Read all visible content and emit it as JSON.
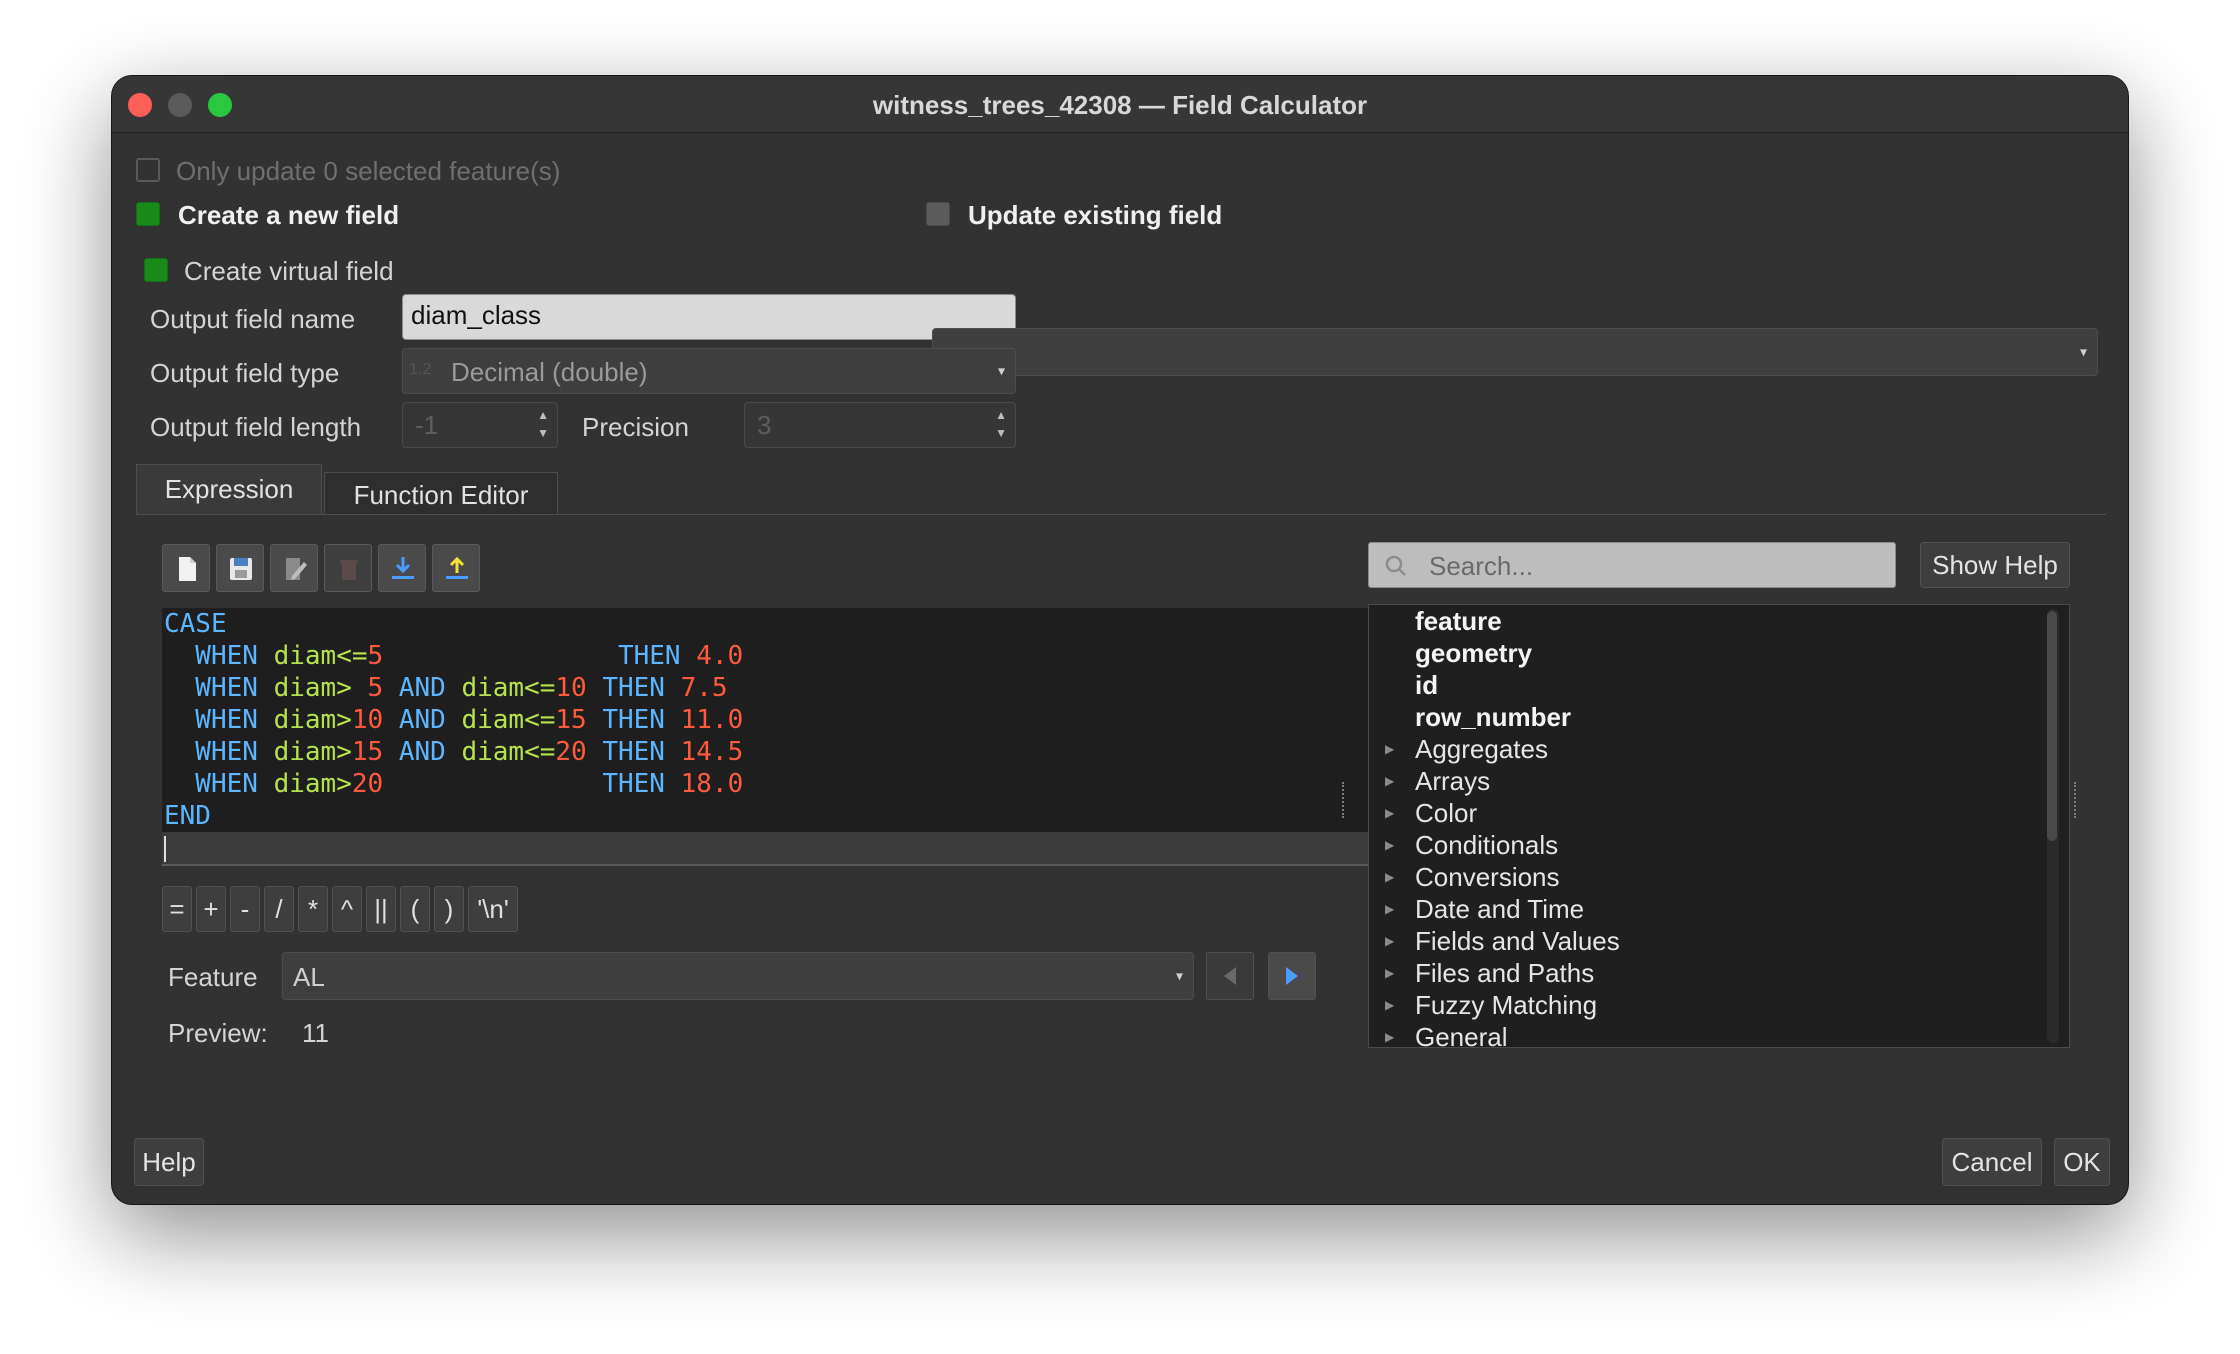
{
  "window": {
    "title": "witness_trees_42308 — Field Calculator"
  },
  "options": {
    "only_update": "Only update 0 selected feature(s)",
    "create_new_field": "Create a new field",
    "update_existing_field": "Update existing field",
    "create_virtual_field": "Create virtual field"
  },
  "fields": {
    "output_name_label": "Output field name",
    "output_name_value": "diam_class",
    "output_type_label": "Output field type",
    "output_type_icon": "1.2",
    "output_type_value": "Decimal (double)",
    "output_length_label": "Output field length",
    "output_length_value": "-1",
    "precision_label": "Precision",
    "precision_value": "3"
  },
  "tabs": [
    {
      "label": "Expression"
    },
    {
      "label": "Function Editor"
    }
  ],
  "toolbar_icons": [
    "new-file-icon",
    "save-icon",
    "edit-icon",
    "delete-icon",
    "import-icon",
    "export-icon"
  ],
  "expression": {
    "lines": [
      {
        "a": "CASE"
      },
      {
        "kw1": "  WHEN ",
        "id1": "diam<=",
        "n1": "5",
        "sp": "               ",
        "kw2": "THEN ",
        "n2": "4.0"
      },
      {
        "kw1": "  WHEN ",
        "id1": "diam> ",
        "n1": "5",
        "mid": " AND ",
        "id2": "diam<=",
        "n1b": "10",
        "kw2": " THEN ",
        "n2": "7.5"
      },
      {
        "kw1": "  WHEN ",
        "id1": "diam>",
        "n1": "10",
        "mid": " AND ",
        "id2": "diam<=",
        "n1b": "15",
        "kw2": " THEN ",
        "n2": "11.0"
      },
      {
        "kw1": "  WHEN ",
        "id1": "diam>",
        "n1": "15",
        "mid": " AND ",
        "id2": "diam<=",
        "n1b": "20",
        "kw2": " THEN ",
        "n2": "14.5"
      },
      {
        "kw1": "  WHEN ",
        "id1": "diam>",
        "n1": "20",
        "sp": "              ",
        "kw2": "THEN ",
        "n2": "18.0"
      },
      {
        "a": "END"
      }
    ]
  },
  "operators": [
    "=",
    "+",
    "-",
    "/",
    "*",
    "^",
    "||",
    "(",
    ")",
    "'\\n'"
  ],
  "feature": {
    "label": "Feature",
    "value": "AL"
  },
  "preview": {
    "label": "Preview:",
    "value": "11"
  },
  "search": {
    "placeholder": "Search..."
  },
  "show_help": "Show Help",
  "tree": {
    "fields": [
      "feature",
      "geometry",
      "id",
      "row_number"
    ],
    "groups": [
      "Aggregates",
      "Arrays",
      "Color",
      "Conditionals",
      "Conversions",
      "Date and Time",
      "Fields and Values",
      "Files and Paths",
      "Fuzzy Matching",
      "General"
    ]
  },
  "buttons": {
    "help": "Help",
    "cancel": "Cancel",
    "ok": "OK"
  },
  "colors": {
    "accent_green": "#1a8a1a",
    "keyword": "#5bb6ff",
    "identifier": "#b6e34b",
    "number": "#ff5a3c"
  }
}
